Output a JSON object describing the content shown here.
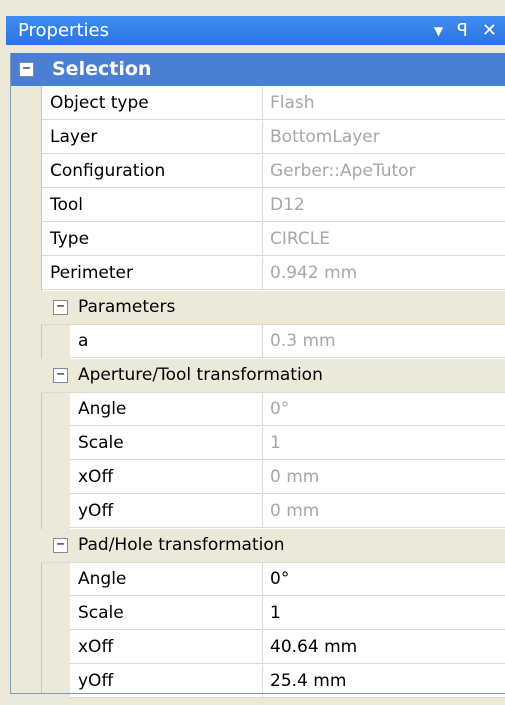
{
  "panel": {
    "title": "Properties",
    "buttons": {
      "dropdown": "▼",
      "pin": "ꟼ",
      "close": "✕"
    }
  },
  "categories": {
    "selection": "Selection",
    "parameters": "Parameters",
    "aperture": "Aperture/Tool transformation",
    "pad": "Pad/Hole transformation"
  },
  "toggle_symbol": "−",
  "selection_rows": [
    {
      "name": "Object type",
      "value": "Flash"
    },
    {
      "name": "Layer",
      "value": "BottomLayer"
    },
    {
      "name": "Configuration",
      "value": "Gerber::ApeTutor"
    },
    {
      "name": "Tool",
      "value": "D12"
    },
    {
      "name": "Type",
      "value": "CIRCLE"
    },
    {
      "name": "Perimeter",
      "value": "0.942 mm"
    }
  ],
  "parameters_rows": [
    {
      "name": "a",
      "value": "0.3 mm"
    }
  ],
  "aperture_rows": [
    {
      "name": "Angle",
      "value": "0°"
    },
    {
      "name": "Scale",
      "value": "1"
    },
    {
      "name": "xOff",
      "value": "0 mm"
    },
    {
      "name": "yOff",
      "value": "0 mm"
    }
  ],
  "pad_rows": [
    {
      "name": "Angle",
      "value": "0°"
    },
    {
      "name": "Scale",
      "value": "1"
    },
    {
      "name": "xOff",
      "value": "40.64 mm"
    },
    {
      "name": "yOff",
      "value": "25.4 mm"
    }
  ]
}
